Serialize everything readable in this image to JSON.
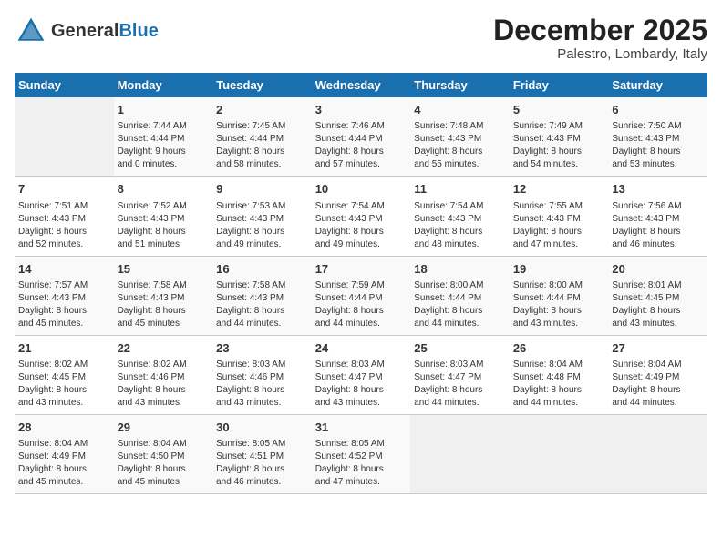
{
  "header": {
    "logo_text_general": "General",
    "logo_text_blue": "Blue",
    "month_title": "December 2025",
    "location": "Palestro, Lombardy, Italy"
  },
  "days_of_week": [
    "Sunday",
    "Monday",
    "Tuesday",
    "Wednesday",
    "Thursday",
    "Friday",
    "Saturday"
  ],
  "weeks": [
    [
      {
        "day": "",
        "info": ""
      },
      {
        "day": "1",
        "info": "Sunrise: 7:44 AM\nSunset: 4:44 PM\nDaylight: 9 hours\nand 0 minutes."
      },
      {
        "day": "2",
        "info": "Sunrise: 7:45 AM\nSunset: 4:44 PM\nDaylight: 8 hours\nand 58 minutes."
      },
      {
        "day": "3",
        "info": "Sunrise: 7:46 AM\nSunset: 4:44 PM\nDaylight: 8 hours\nand 57 minutes."
      },
      {
        "day": "4",
        "info": "Sunrise: 7:48 AM\nSunset: 4:43 PM\nDaylight: 8 hours\nand 55 minutes."
      },
      {
        "day": "5",
        "info": "Sunrise: 7:49 AM\nSunset: 4:43 PM\nDaylight: 8 hours\nand 54 minutes."
      },
      {
        "day": "6",
        "info": "Sunrise: 7:50 AM\nSunset: 4:43 PM\nDaylight: 8 hours\nand 53 minutes."
      }
    ],
    [
      {
        "day": "7",
        "info": "Sunrise: 7:51 AM\nSunset: 4:43 PM\nDaylight: 8 hours\nand 52 minutes."
      },
      {
        "day": "8",
        "info": "Sunrise: 7:52 AM\nSunset: 4:43 PM\nDaylight: 8 hours\nand 51 minutes."
      },
      {
        "day": "9",
        "info": "Sunrise: 7:53 AM\nSunset: 4:43 PM\nDaylight: 8 hours\nand 49 minutes."
      },
      {
        "day": "10",
        "info": "Sunrise: 7:54 AM\nSunset: 4:43 PM\nDaylight: 8 hours\nand 49 minutes."
      },
      {
        "day": "11",
        "info": "Sunrise: 7:54 AM\nSunset: 4:43 PM\nDaylight: 8 hours\nand 48 minutes."
      },
      {
        "day": "12",
        "info": "Sunrise: 7:55 AM\nSunset: 4:43 PM\nDaylight: 8 hours\nand 47 minutes."
      },
      {
        "day": "13",
        "info": "Sunrise: 7:56 AM\nSunset: 4:43 PM\nDaylight: 8 hours\nand 46 minutes."
      }
    ],
    [
      {
        "day": "14",
        "info": "Sunrise: 7:57 AM\nSunset: 4:43 PM\nDaylight: 8 hours\nand 45 minutes."
      },
      {
        "day": "15",
        "info": "Sunrise: 7:58 AM\nSunset: 4:43 PM\nDaylight: 8 hours\nand 45 minutes."
      },
      {
        "day": "16",
        "info": "Sunrise: 7:58 AM\nSunset: 4:43 PM\nDaylight: 8 hours\nand 44 minutes."
      },
      {
        "day": "17",
        "info": "Sunrise: 7:59 AM\nSunset: 4:44 PM\nDaylight: 8 hours\nand 44 minutes."
      },
      {
        "day": "18",
        "info": "Sunrise: 8:00 AM\nSunset: 4:44 PM\nDaylight: 8 hours\nand 44 minutes."
      },
      {
        "day": "19",
        "info": "Sunrise: 8:00 AM\nSunset: 4:44 PM\nDaylight: 8 hours\nand 43 minutes."
      },
      {
        "day": "20",
        "info": "Sunrise: 8:01 AM\nSunset: 4:45 PM\nDaylight: 8 hours\nand 43 minutes."
      }
    ],
    [
      {
        "day": "21",
        "info": "Sunrise: 8:02 AM\nSunset: 4:45 PM\nDaylight: 8 hours\nand 43 minutes."
      },
      {
        "day": "22",
        "info": "Sunrise: 8:02 AM\nSunset: 4:46 PM\nDaylight: 8 hours\nand 43 minutes."
      },
      {
        "day": "23",
        "info": "Sunrise: 8:03 AM\nSunset: 4:46 PM\nDaylight: 8 hours\nand 43 minutes."
      },
      {
        "day": "24",
        "info": "Sunrise: 8:03 AM\nSunset: 4:47 PM\nDaylight: 8 hours\nand 43 minutes."
      },
      {
        "day": "25",
        "info": "Sunrise: 8:03 AM\nSunset: 4:47 PM\nDaylight: 8 hours\nand 44 minutes."
      },
      {
        "day": "26",
        "info": "Sunrise: 8:04 AM\nSunset: 4:48 PM\nDaylight: 8 hours\nand 44 minutes."
      },
      {
        "day": "27",
        "info": "Sunrise: 8:04 AM\nSunset: 4:49 PM\nDaylight: 8 hours\nand 44 minutes."
      }
    ],
    [
      {
        "day": "28",
        "info": "Sunrise: 8:04 AM\nSunset: 4:49 PM\nDaylight: 8 hours\nand 45 minutes."
      },
      {
        "day": "29",
        "info": "Sunrise: 8:04 AM\nSunset: 4:50 PM\nDaylight: 8 hours\nand 45 minutes."
      },
      {
        "day": "30",
        "info": "Sunrise: 8:05 AM\nSunset: 4:51 PM\nDaylight: 8 hours\nand 46 minutes."
      },
      {
        "day": "31",
        "info": "Sunrise: 8:05 AM\nSunset: 4:52 PM\nDaylight: 8 hours\nand 47 minutes."
      },
      {
        "day": "",
        "info": ""
      },
      {
        "day": "",
        "info": ""
      },
      {
        "day": "",
        "info": ""
      }
    ]
  ]
}
